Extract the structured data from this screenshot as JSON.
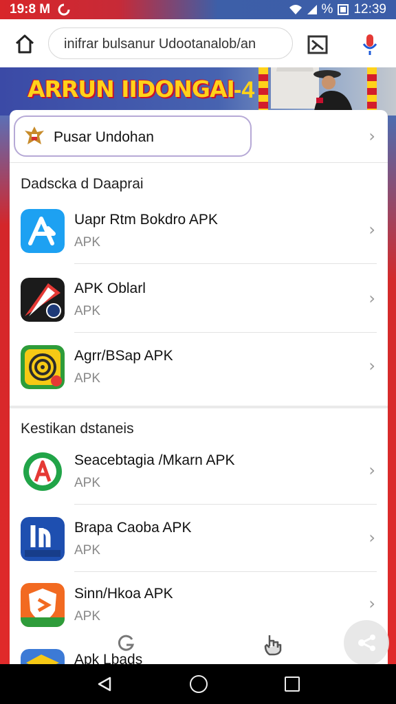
{
  "status": {
    "time_left": "19:8 M",
    "battery_text": "%",
    "time_right": "12:39"
  },
  "browser": {
    "url": "inifrar bulsanur Udootanalob/an"
  },
  "banner": {
    "title": "ARRUN IIDONGAI",
    "deco": "-4"
  },
  "portal": {
    "label": "Pusar Undohan"
  },
  "sections": [
    {
      "title": "Dadscka d Daaprai",
      "items": [
        {
          "name": "Uapr Rtm Bokdro APK",
          "sub": "APK",
          "icon": "blue-a-arrow-icon"
        },
        {
          "name": "APK Oblarl",
          "sub": "APK",
          "icon": "red-speed-arrow-icon"
        },
        {
          "name": "Agrr/BSap APK",
          "sub": "APK",
          "icon": "yellow-spiral-icon"
        }
      ]
    },
    {
      "title": "Kestikan dstaneis",
      "items": [
        {
          "name": "Seacebtagia /Mkarn APK",
          "sub": "APK",
          "icon": "green-a-circle-icon"
        },
        {
          "name": "Brapa Caoba APK",
          "sub": "APK",
          "icon": "blue-book-icon"
        },
        {
          "name": "Sinn/Hkoa APK",
          "sub": "APK",
          "icon": "orange-shield-icon"
        },
        {
          "name": "Apk Lbads",
          "sub": "",
          "icon": "yellow-folder-icon"
        }
      ]
    }
  ],
  "colors": {
    "accent_red": "#e02a2a",
    "accent_blue": "#3d5fa8",
    "banner_yellow": "#ffd21a"
  }
}
